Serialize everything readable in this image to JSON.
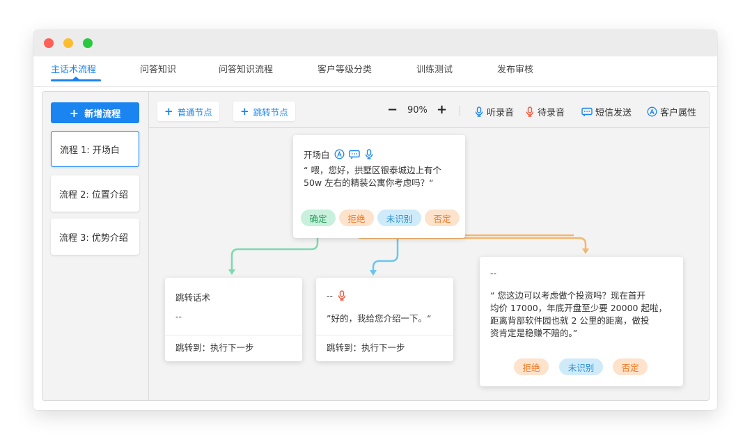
{
  "tabs": [
    {
      "label": "主话术流程",
      "active": true
    },
    {
      "label": "问答知识"
    },
    {
      "label": "问答知识流程"
    },
    {
      "label": "客户等级分类"
    },
    {
      "label": "训练测试"
    },
    {
      "label": "发布审核"
    }
  ],
  "sidebar": {
    "add_flow_label": "新增流程",
    "add_flow_icon": "plus",
    "flows": [
      {
        "label": "流程 1: 开场白",
        "active": true
      },
      {
        "label": "流程 2: 位置介绍"
      },
      {
        "label": "流程 3: 优势介绍"
      }
    ]
  },
  "toolbar": {
    "normal_node_label": "普通节点",
    "jump_node_label": "跳转节点",
    "zoom_minus": "−",
    "zoom_value": "90%",
    "zoom_plus": "+",
    "legend": [
      {
        "label": "听录音",
        "icon": "mic-icon",
        "color": "#1a84f0"
      },
      {
        "label": "待录音",
        "icon": "mic-icon",
        "color": "#f0553a"
      },
      {
        "label": "短信发送",
        "icon": "sms-icon",
        "color": "#1a84f0"
      },
      {
        "label": "客户属性",
        "icon": "attribute-icon",
        "color": "#1a84f0"
      }
    ]
  },
  "nodes": {
    "opening": {
      "title": "开场白",
      "text_line1": "“ 喂，您好，拱墅区银泰城边上有个",
      "text_line2": "50w 左右的精装公寓你考虑吗？“",
      "branches": [
        {
          "label": "确定",
          "color": "green"
        },
        {
          "label": "拒绝",
          "color": "orange"
        },
        {
          "label": "未识别",
          "color": "blue"
        },
        {
          "label": "否定",
          "color": "orange"
        }
      ]
    },
    "jump": {
      "title": "跳转话术",
      "text": "--",
      "footer": "跳转到：执行下一步"
    },
    "intro": {
      "title": "--",
      "text": "”好的，我给您介绍一下。“",
      "footer": "跳转到：执行下一步"
    },
    "invest": {
      "title": "--",
      "lines": [
        "“ 您这边可以考虑做个投资吗？现在首开",
        "均价 17000，年底开盘至少要 20000 起啦，",
        "距离背部软件园也就 2 公里的距离，做投",
        "资肯定是稳赚不赔的。”"
      ],
      "branches": [
        {
          "label": "拒绝",
          "color": "orange"
        },
        {
          "label": "未识别",
          "color": "blue"
        },
        {
          "label": "否定",
          "color": "orange"
        }
      ]
    }
  },
  "colors": {
    "accent": "#1a84f0",
    "green_line": "#7dd9b0",
    "blue_line": "#6cc5ee",
    "orange_line": "#f5b66a",
    "record_pending": "#f0553a"
  }
}
